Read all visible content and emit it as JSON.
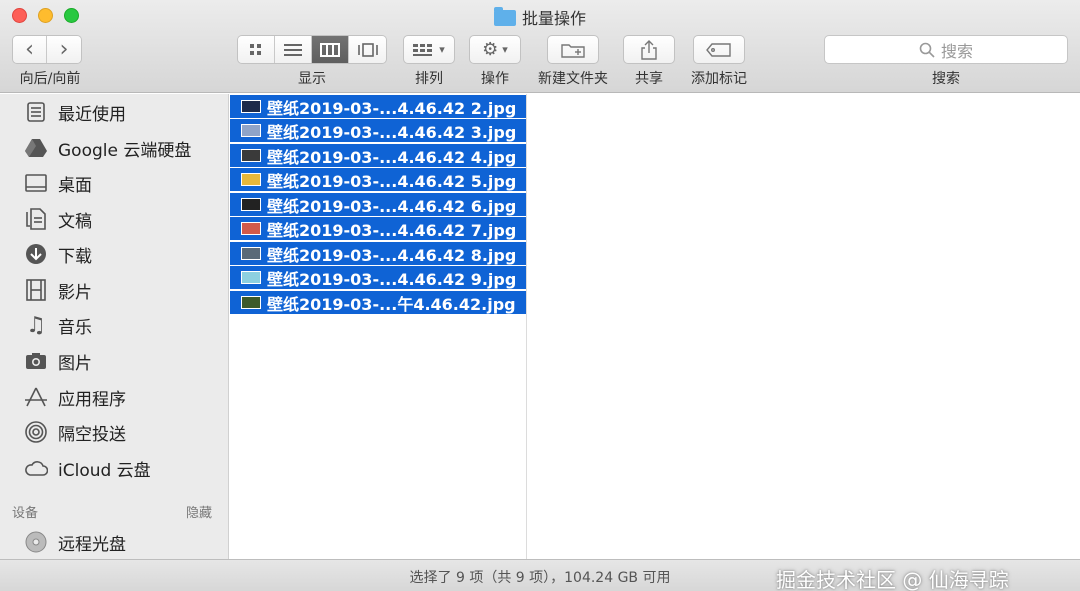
{
  "window": {
    "title": "批量操作"
  },
  "toolbar": {
    "nav_label": "向后/向前",
    "back_glyph": "‹",
    "forward_glyph": "›",
    "view_label": "显示",
    "arrange_label": "排列",
    "action_label": "操作",
    "new_folder_label": "新建文件夹",
    "share_label": "共享",
    "tag_label": "添加标记",
    "search_placeholder": "搜索",
    "search_label": "搜索"
  },
  "sidebar": {
    "items": [
      {
        "label": "最近使用",
        "icon": "recents-icon"
      },
      {
        "label": "Google 云端硬盘",
        "icon": "google-drive-icon"
      },
      {
        "label": "桌面",
        "icon": "desktop-icon"
      },
      {
        "label": "文稿",
        "icon": "documents-icon"
      },
      {
        "label": "下载",
        "icon": "downloads-icon"
      },
      {
        "label": "影片",
        "icon": "movies-icon"
      },
      {
        "label": "音乐",
        "icon": "music-icon"
      },
      {
        "label": "图片",
        "icon": "pictures-icon"
      },
      {
        "label": "应用程序",
        "icon": "applications-icon"
      },
      {
        "label": "隔空投送",
        "icon": "airdrop-icon"
      },
      {
        "label": "iCloud 云盘",
        "icon": "icloud-icon"
      }
    ],
    "devices_header": "设备",
    "hide_label": "隐藏",
    "devices": [
      {
        "label": "远程光盘",
        "icon": "remote-disc-icon"
      }
    ]
  },
  "files": [
    {
      "name": "壁纸2019-03-...4.46.42 2.jpg",
      "thumb_color": "#1d2a4a"
    },
    {
      "name": "壁纸2019-03-...4.46.42 3.jpg",
      "thumb_color": "#8fa4c8"
    },
    {
      "name": "壁纸2019-03-...4.46.42 4.jpg",
      "thumb_color": "#3a3a3a"
    },
    {
      "name": "壁纸2019-03-...4.46.42 5.jpg",
      "thumb_color": "#e8b83a"
    },
    {
      "name": "壁纸2019-03-...4.46.42 6.jpg",
      "thumb_color": "#222222"
    },
    {
      "name": "壁纸2019-03-...4.46.42 7.jpg",
      "thumb_color": "#d25a4a"
    },
    {
      "name": "壁纸2019-03-...4.46.42 8.jpg",
      "thumb_color": "#5a6a78"
    },
    {
      "name": "壁纸2019-03-...4.46.42 9.jpg",
      "thumb_color": "#8cd0e0"
    },
    {
      "name": "壁纸2019-03-...午4.46.42.jpg",
      "thumb_color": "#3d5a2a"
    }
  ],
  "status": {
    "text": "选择了 9 项（共 9 项），104.24 GB 可用"
  },
  "watermark": "掘金技术社区 @ 仙海寻踪"
}
